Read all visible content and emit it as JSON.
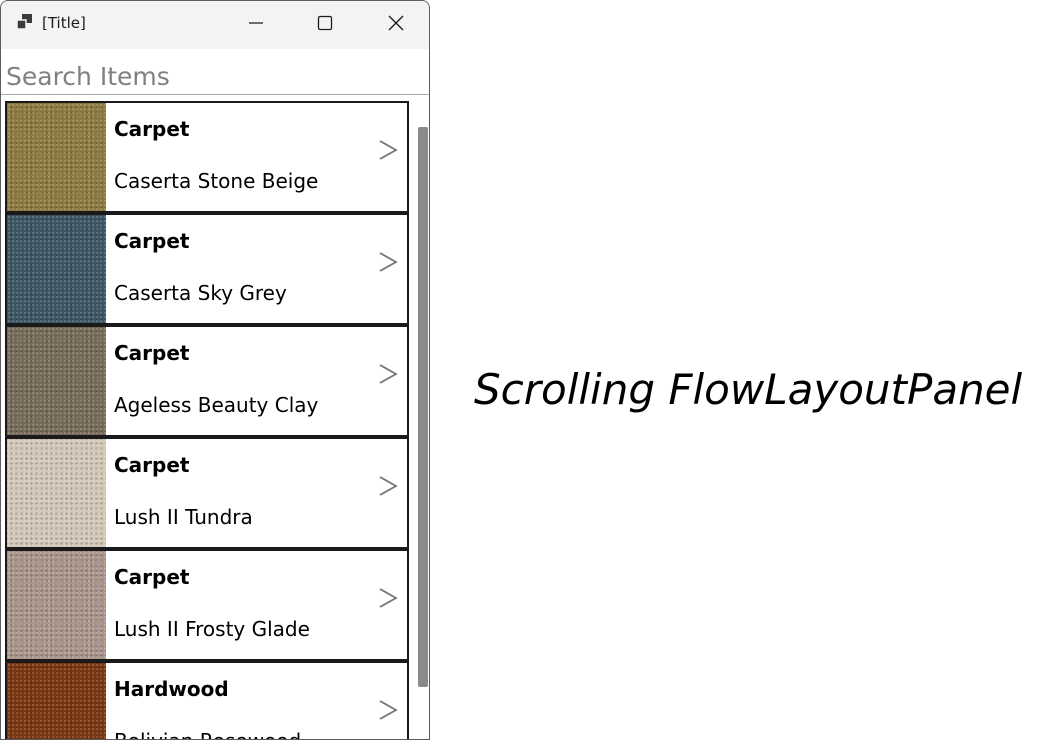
{
  "window": {
    "title": "[Title]",
    "app_icon": "app-window-icon",
    "controls": {
      "minimize_icon": "minimize-icon",
      "maximize_icon": "maximize-icon",
      "close_icon": "close-icon"
    }
  },
  "search": {
    "placeholder": "Search Items",
    "value": ""
  },
  "items": [
    {
      "category": "Carpet",
      "name": "Caserta Stone Beige",
      "swatch": "#8d7a3f"
    },
    {
      "category": "Carpet",
      "name": "Caserta Sky Grey",
      "swatch": "#3b5563"
    },
    {
      "category": "Carpet",
      "name": "Ageless Beauty Clay",
      "swatch": "#776a59"
    },
    {
      "category": "Carpet",
      "name": "Lush II Tundra",
      "swatch": "#d4c8b8"
    },
    {
      "category": "Carpet",
      "name": "Lush II Frosty Glade",
      "swatch": "#a9958a"
    },
    {
      "category": "Hardwood",
      "name": "Bolivian Rosewood",
      "swatch": "#7a3410"
    }
  ],
  "item_arrow_icon": "chevron-right-icon",
  "caption": "Scrolling FlowLayoutPanel"
}
